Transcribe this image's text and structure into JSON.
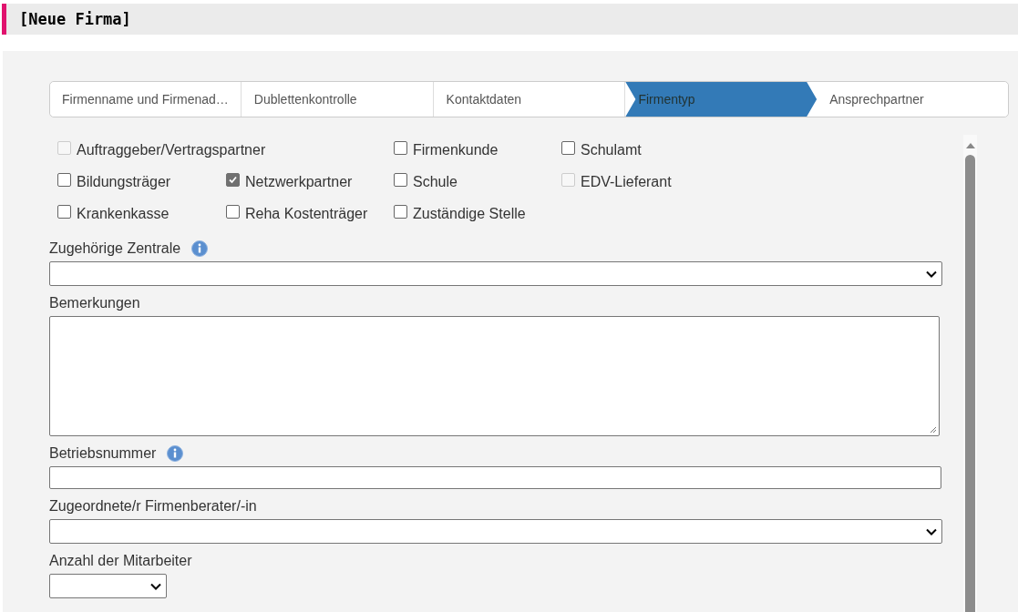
{
  "title": "[Neue Firma]",
  "steps": [
    {
      "label": "Firmenname und Firmenad…",
      "selected": false
    },
    {
      "label": "Dublettenkontrolle",
      "selected": false
    },
    {
      "label": "Kontaktdaten",
      "selected": false
    },
    {
      "label": "Firmentyp",
      "selected": true
    },
    {
      "label": "Ansprechpartner",
      "selected": false
    }
  ],
  "company_types": [
    {
      "label": "Auftraggeber/Vertragspartner",
      "checked": false,
      "disabled": true
    },
    {
      "label": "Firmenkunde",
      "checked": false,
      "disabled": false
    },
    {
      "label": "Schulamt",
      "checked": false,
      "disabled": false
    },
    {
      "label": "Bildungsträger",
      "checked": false,
      "disabled": false
    },
    {
      "label": "Netzwerkpartner",
      "checked": true,
      "disabled": false
    },
    {
      "label": "Schule",
      "checked": false,
      "disabled": false
    },
    {
      "label": "EDV-Lieferant",
      "checked": false,
      "disabled": true
    },
    {
      "label": "Krankenkasse",
      "checked": false,
      "disabled": false
    },
    {
      "label": "Reha Kostenträger",
      "checked": false,
      "disabled": false
    },
    {
      "label": "Zuständige Stelle",
      "checked": false,
      "disabled": false
    }
  ],
  "fields": [
    {
      "label": "Zugehörige Zentrale",
      "kind": "select",
      "info": true
    },
    {
      "label": "Bemerkungen",
      "kind": "textarea",
      "info": false
    },
    {
      "label": "Betriebsnummer",
      "kind": "text",
      "info": true
    },
    {
      "label": "Zugeordnete/r Firmenberater/-in",
      "kind": "select",
      "info": false
    },
    {
      "label": "Anzahl der Mitarbeiter",
      "kind": "small-select",
      "info": false
    }
  ]
}
